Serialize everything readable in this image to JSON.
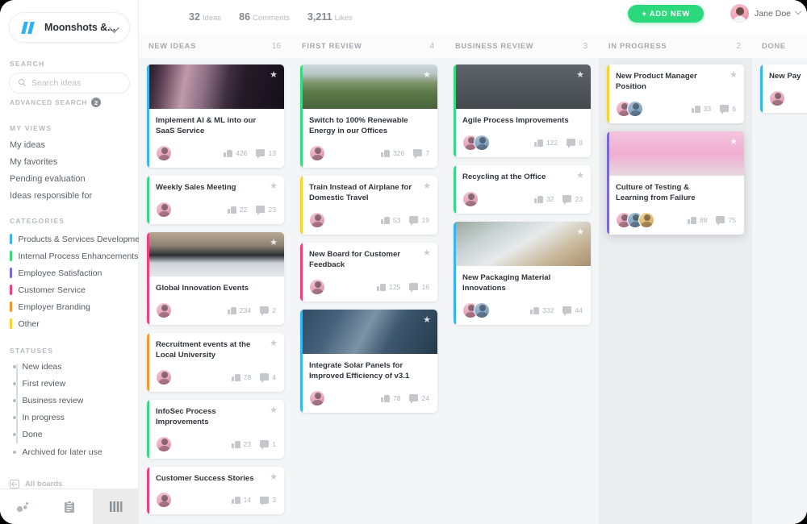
{
  "sidebar": {
    "board": {
      "name": "Moonshots &...",
      "logo_icon": "double-slash-logo",
      "chevron_icon": "chevron-down-icon"
    },
    "search": {
      "heading": "SEARCH",
      "placeholder": "Search ideas",
      "value": "",
      "icon": "search-icon",
      "advanced_label": "ADVANCED SEARCH",
      "advanced_count": "2"
    },
    "my_views": {
      "heading": "MY VIEWS",
      "items": [
        {
          "label": "My ideas"
        },
        {
          "label": "My favorites"
        },
        {
          "label": "Pending evaluation"
        },
        {
          "label": "Ideas responsible for"
        }
      ]
    },
    "categories": {
      "heading": "CATEGORIES",
      "items": [
        {
          "label": "Products & Services Development",
          "color": "#35b6ec"
        },
        {
          "label": "Internal Process Enhancements",
          "color": "#36d97f"
        },
        {
          "label": "Employee Satisfaction",
          "color": "#7b68d8"
        },
        {
          "label": "Customer Service",
          "color": "#f0407f"
        },
        {
          "label": "Employer Branding",
          "color": "#f7962c"
        },
        {
          "label": "Other",
          "color": "#f7d32c"
        }
      ]
    },
    "statuses": {
      "heading": "STATUSES",
      "items": [
        {
          "label": "New ideas"
        },
        {
          "label": "First review"
        },
        {
          "label": "Business review"
        },
        {
          "label": "In progress"
        },
        {
          "label": "Done"
        },
        {
          "label": "Archived for later use"
        }
      ]
    },
    "all_boards": {
      "label": "All boards",
      "icon": "back-to-boards-icon"
    },
    "bottom_nav": [
      {
        "name": "insights-icon",
        "active": false
      },
      {
        "name": "list-view-icon",
        "active": false
      },
      {
        "name": "board-view-icon",
        "active": true
      }
    ]
  },
  "topbar": {
    "stats": [
      {
        "value": "32",
        "label": "Ideas"
      },
      {
        "value": "86",
        "label": "Comments"
      },
      {
        "value": "3,211",
        "label": "Likes"
      }
    ],
    "add_new_label": "+ ADD NEW",
    "add_new_color": "#2bd97c",
    "user": {
      "name": "Jane Doe",
      "avatar_icon": "avatar",
      "chevron_icon": "chevron-down-icon"
    }
  },
  "board": {
    "columns": [
      {
        "title": "NEW IDEAS",
        "count": "16",
        "highlight": false,
        "cards": [
          {
            "title": "Implement AI & ML into our SaaS Service",
            "accent": "#35b6ec",
            "likes": "426",
            "comments": "13",
            "avatars": 1,
            "has_image": true,
            "image": "fiber-optic",
            "starred": true
          },
          {
            "title": "Weekly Sales Meeting",
            "accent": "#36d97f",
            "likes": "22",
            "comments": "23",
            "avatars": 1,
            "has_image": false,
            "starred": false
          },
          {
            "title": "Global Innovation Events",
            "accent": "#f0407f",
            "likes": "234",
            "comments": "2",
            "avatars": 1,
            "has_image": true,
            "image": "conference-hall",
            "starred": true
          },
          {
            "title": "Recruitment events at the Local University",
            "accent": "#f7962c",
            "likes": "78",
            "comments": "4",
            "avatars": 1,
            "has_image": false,
            "starred": false
          },
          {
            "title": "InfoSec Process Improvements",
            "accent": "#36d97f",
            "likes": "23",
            "comments": "1",
            "avatars": 1,
            "has_image": false,
            "starred": false
          },
          {
            "title": "Customer Success Stories",
            "accent": "#f0407f",
            "likes": "14",
            "comments": "3",
            "avatars": 1,
            "has_image": false,
            "starred": false
          }
        ]
      },
      {
        "title": "FIRST REVIEW",
        "count": "4",
        "highlight": false,
        "cards": [
          {
            "title": "Switch to 100% Renewable Energy in our Offices",
            "accent": "#36d97f",
            "likes": "326",
            "comments": "7",
            "avatars": 1,
            "has_image": true,
            "image": "wind-turbines",
            "starred": true
          },
          {
            "title": "Train Instead of Airplane for Domestic Travel",
            "accent": "#f7d32c",
            "likes": "53",
            "comments": "19",
            "avatars": 1,
            "has_image": false,
            "starred": false
          },
          {
            "title": "New Board for Customer Feedback",
            "accent": "#f0407f",
            "likes": "125",
            "comments": "16",
            "avatars": 1,
            "has_image": false,
            "starred": false
          },
          {
            "title": "Integrate Solar Panels for Improved Efficiency of v3.1",
            "accent": "#35b6ec",
            "likes": "78",
            "comments": "24",
            "avatars": 1,
            "has_image": true,
            "image": "solar-panels",
            "starred": true
          }
        ]
      },
      {
        "title": "BUSINESS REVIEW",
        "count": "3",
        "highlight": false,
        "cards": [
          {
            "title": "Agile Process Improvements",
            "accent": "#36d97f",
            "likes": "122",
            "comments": "9",
            "avatars": 2,
            "has_image": true,
            "image": "cardboard-boxes",
            "starred": true
          },
          {
            "title": "Recycling at the Office",
            "accent": "#36d97f",
            "likes": "32",
            "comments": "23",
            "avatars": 1,
            "has_image": false,
            "starred": false
          },
          {
            "title": "New Packaging Material Innovations",
            "accent": "#35b6ec",
            "likes": "332",
            "comments": "44",
            "avatars": 2,
            "has_image": true,
            "image": "packaging-material",
            "starred": true
          }
        ]
      },
      {
        "title": "IN PROGRESS",
        "count": "2",
        "highlight": true,
        "cards": [
          {
            "title": "New Product Manager Position",
            "accent": "#f7d32c",
            "likes": "33",
            "comments": "6",
            "avatars": 2,
            "has_image": false,
            "starred": false
          },
          {
            "title": "Culture of Testing & Learning from Failure",
            "accent": "#7b68d8",
            "likes": "88",
            "comments": "75",
            "avatars": 3,
            "has_image": true,
            "image": "sticky-notes",
            "starred": true,
            "selected": true
          }
        ]
      },
      {
        "title": "DONE",
        "count": "",
        "highlight": false,
        "cards": [
          {
            "title": "New Pay",
            "accent": "#35b6ec",
            "likes": "",
            "comments": "",
            "avatars": 1,
            "has_image": false,
            "starred": false
          }
        ]
      }
    ]
  }
}
